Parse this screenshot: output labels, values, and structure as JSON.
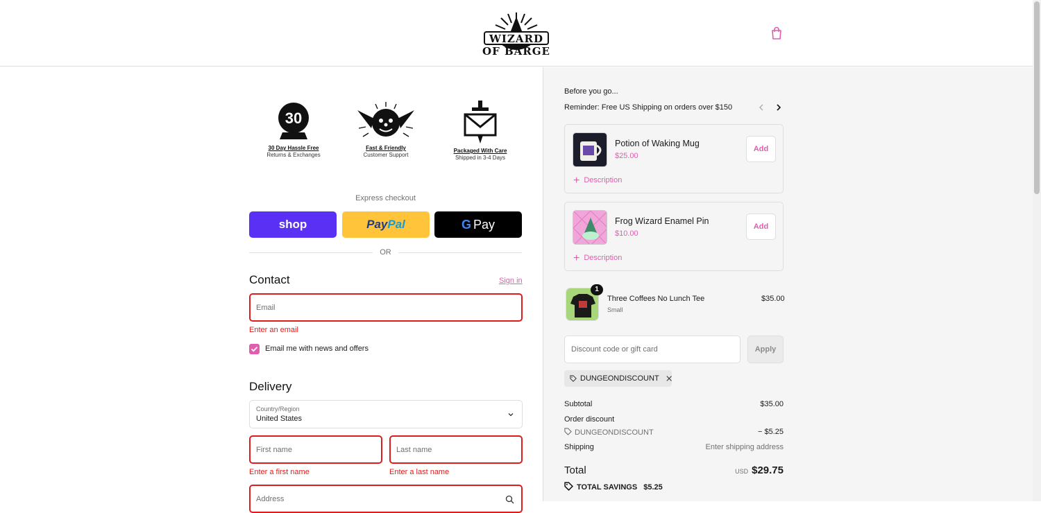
{
  "header": {
    "logo_text": "WIZARD OF BARGE",
    "cart_icon": "shopping-bag-icon"
  },
  "badges": [
    {
      "title": "30 Day Hassle Free",
      "sub": "Returns & Exchanges",
      "number": "30"
    },
    {
      "title": "Fast & Friendly",
      "sub": "Customer Support"
    },
    {
      "title": "Packaged With Care",
      "sub": "Shipped in 3-4 Days"
    }
  ],
  "express": {
    "label": "Express checkout",
    "shop": "shop",
    "paypal": "PayPal",
    "gpay_g": "G",
    "gpay": "Pay",
    "or": "OR"
  },
  "contact": {
    "heading": "Contact",
    "signin": "Sign in",
    "email_placeholder": "Email",
    "email_error": "Enter an email",
    "newsletter_label": "Email me with news and offers",
    "newsletter_checked": true
  },
  "delivery": {
    "heading": "Delivery",
    "country_label": "Country/Region",
    "country_value": "United States",
    "first_placeholder": "First name",
    "last_placeholder": "Last name",
    "first_error": "Enter a first name",
    "last_error": "Enter a last name",
    "address_placeholder": "Address"
  },
  "summary": {
    "before_go": "Before you go...",
    "reminder": "Reminder: Free US Shipping on orders over $150",
    "upsells": [
      {
        "name": "Potion of Waking Mug",
        "price": "$25.00",
        "add": "Add",
        "desc": "Description"
      },
      {
        "name": "Frog Wizard Enamel Pin",
        "price": "$10.00",
        "add": "Add",
        "desc": "Description"
      }
    ],
    "item": {
      "name": "Three Coffees No Lunch Tee",
      "variant": "Small",
      "price": "$35.00",
      "quantity": "1"
    },
    "discount_placeholder": "Discount code or gift card",
    "apply": "Apply",
    "applied_code": "DUNGEONDISCOUNT",
    "subtotal_label": "Subtotal",
    "subtotal": "$35.00",
    "order_discount_label": "Order discount",
    "discount_code": "DUNGEONDISCOUNT",
    "discount_amount": "− $5.25",
    "shipping_label": "Shipping",
    "shipping_value": "Enter shipping address",
    "total_label": "Total",
    "currency": "USD",
    "total": "$29.75",
    "savings_label": "TOTAL SAVINGS",
    "savings": "$5.25"
  },
  "colors": {
    "accent": "#e05db0",
    "error": "#dd1d1d",
    "shop": "#5a31f4",
    "paypal": "#ffc439"
  }
}
